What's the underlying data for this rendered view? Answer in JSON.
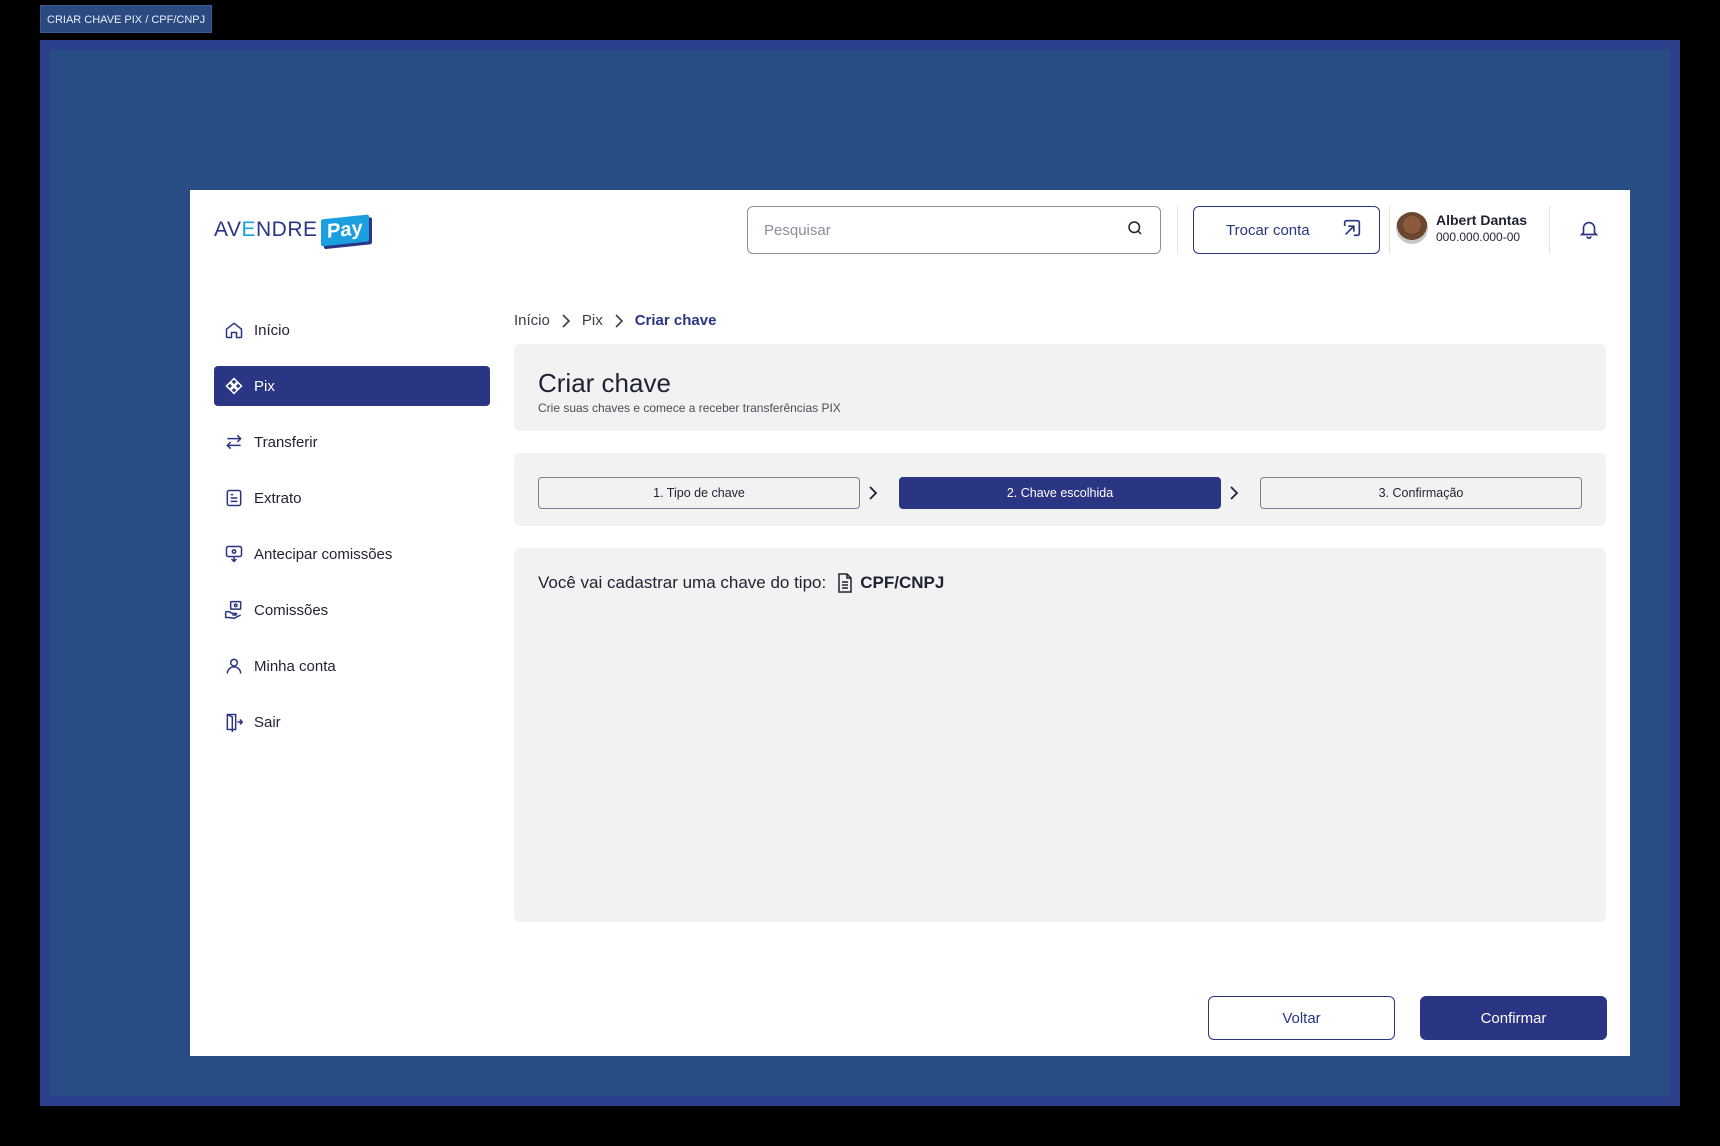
{
  "frame": {
    "label": "CRIAR CHAVE PIX / CPF/CNPJ"
  },
  "header": {
    "logo_main": "AV",
    "logo_e": "E",
    "logo_rest": "NDRE",
    "logo_pay": "Pay",
    "search_placeholder": "Pesquisar",
    "switch_account_label": "Trocar conta",
    "user": {
      "name": "Albert Dantas",
      "document": "000.000.000-00"
    }
  },
  "sidebar": {
    "items": [
      {
        "label": "Início",
        "icon": "home-icon",
        "active": false
      },
      {
        "label": "Pix",
        "icon": "pix-icon",
        "active": true
      },
      {
        "label": "Transferir",
        "icon": "transfer-icon",
        "active": false
      },
      {
        "label": "Extrato",
        "icon": "statement-icon",
        "active": false
      },
      {
        "label": "Antecipar comissões",
        "icon": "anticipate-icon",
        "active": false
      },
      {
        "label": "Comissões",
        "icon": "commissions-icon",
        "active": false
      },
      {
        "label": "Minha conta",
        "icon": "user-icon",
        "active": false
      },
      {
        "label": "Sair",
        "icon": "logout-icon",
        "active": false
      }
    ]
  },
  "breadcrumb": {
    "items": [
      "Início",
      "Pix",
      "Criar chave"
    ]
  },
  "page": {
    "title": "Criar chave",
    "subtitle": "Crie suas chaves e comece a receber transferências PIX"
  },
  "steps": [
    {
      "label": "1. Tipo de chave",
      "active": false
    },
    {
      "label": "2. Chave escolhida",
      "active": true
    },
    {
      "label": "3. Confirmação",
      "active": false
    }
  ],
  "content": {
    "prompt": "Você vai cadastrar uma chave do tipo:",
    "key_type": "CPF/CNPJ"
  },
  "actions": {
    "back_label": "Voltar",
    "confirm_label": "Confirmar"
  },
  "colors": {
    "primary": "#2a3584",
    "accent": "#1aa0e0",
    "card_bg": "#f2f2f2",
    "frame_bg": "#284c84"
  }
}
